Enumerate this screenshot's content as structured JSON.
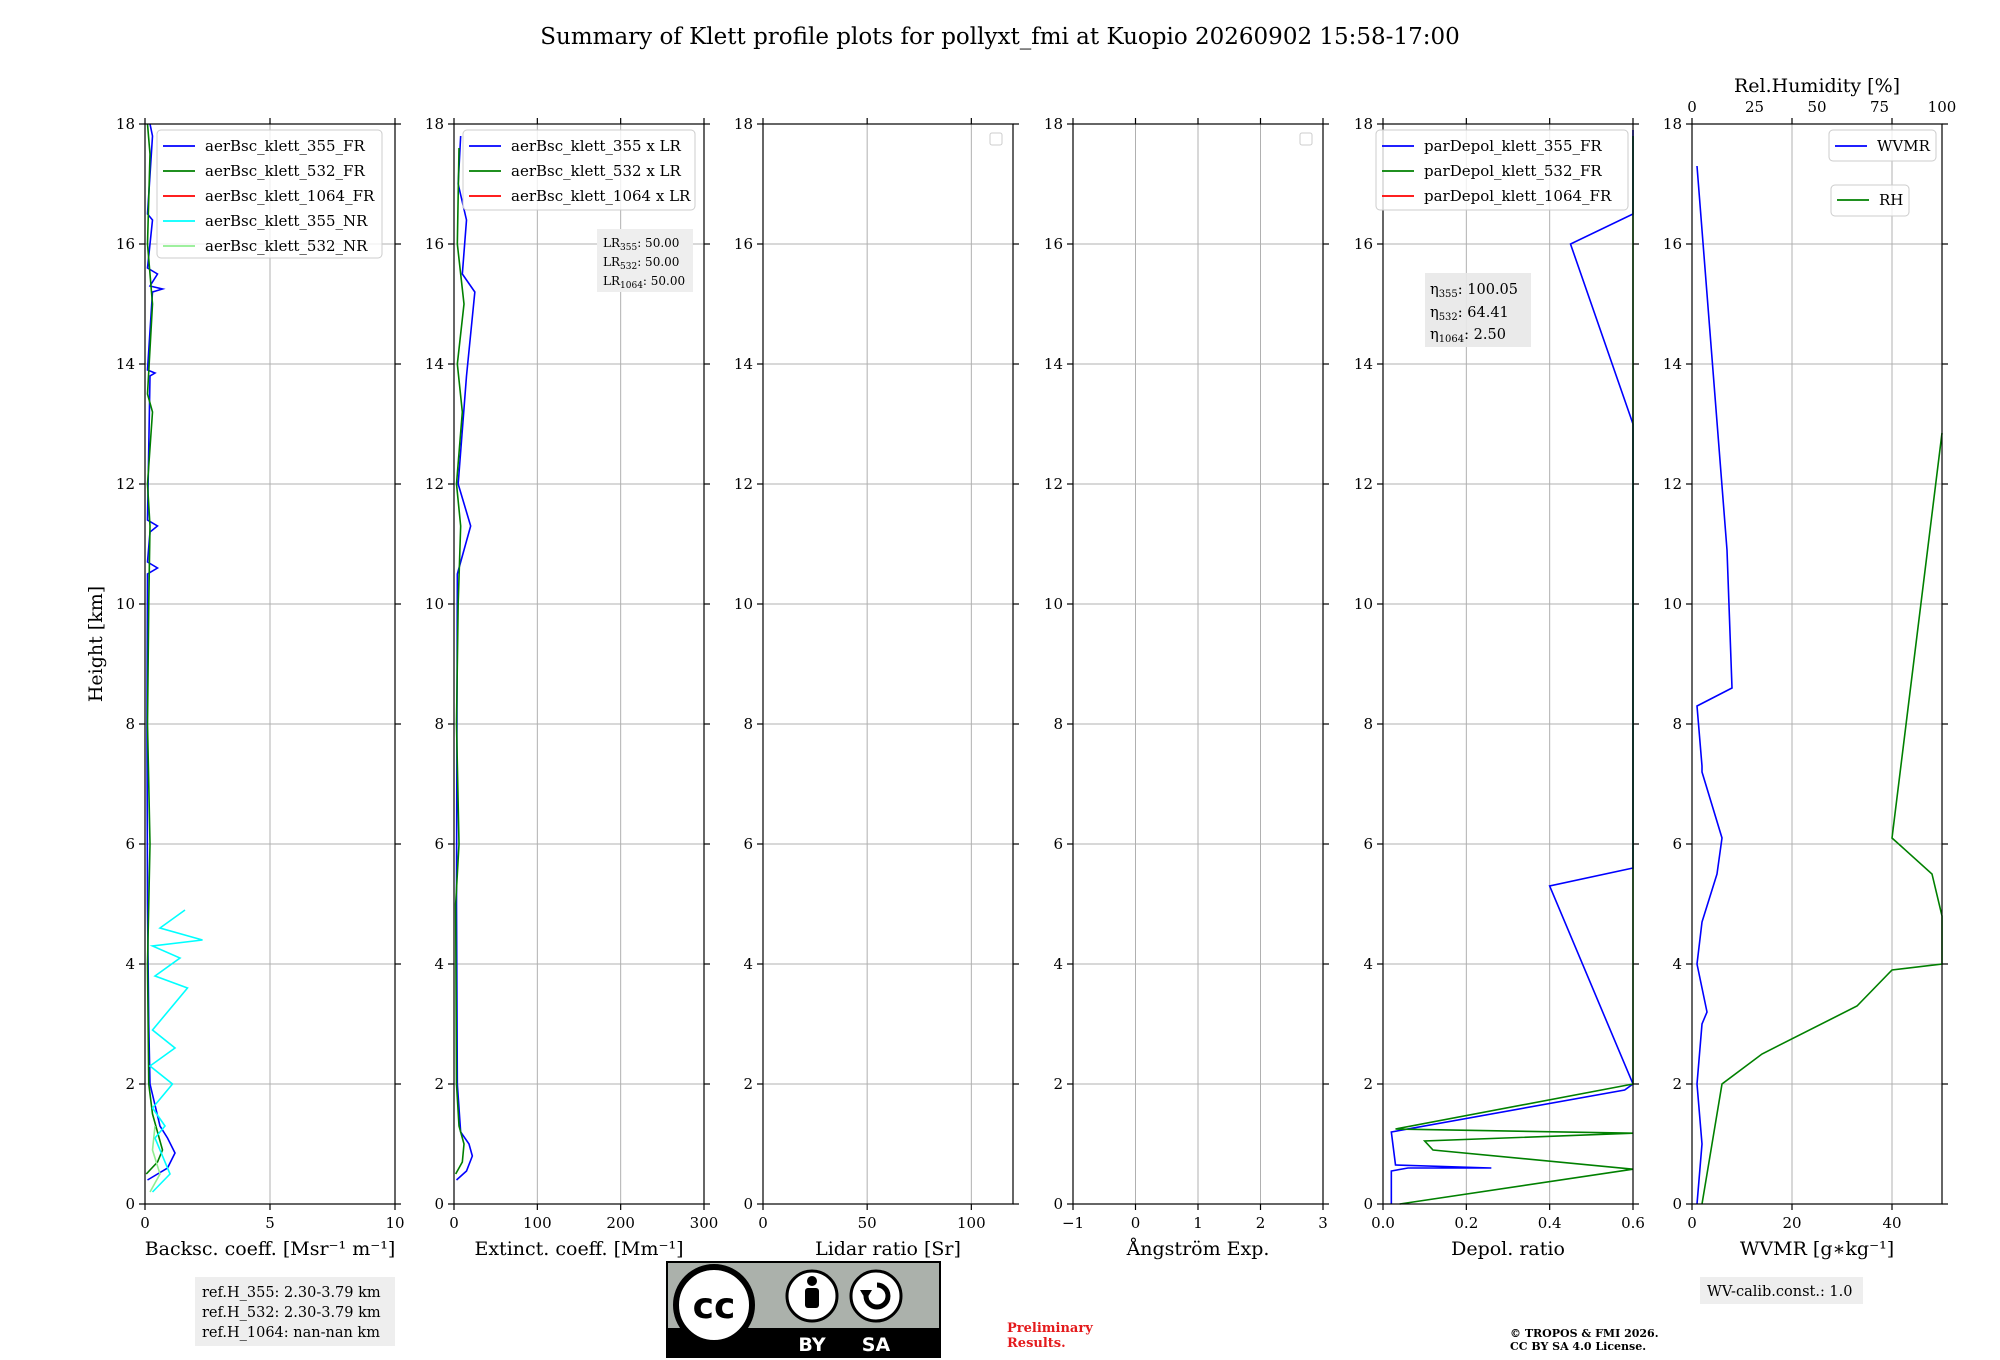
{
  "figure": {
    "title": "Summary of Klett profile plots for pollyxt_fmi at Kuopio 20260902 15:58-17:00",
    "ylabel": "Height [km]",
    "preliminary": [
      "Preliminary",
      "Results."
    ],
    "copyright": [
      "© TROPOS & FMI 2026.",
      "CC BY SA 4.0 License."
    ],
    "cc_badge": {
      "by": "BY",
      "sa": "SA",
      "cc": "cc"
    },
    "colors": {
      "blue": "#0000ff",
      "green": "#008000",
      "red": "#ff0000",
      "cyan": "#00ffff",
      "lightgreen": "#90ee90",
      "grid": "#b0b0b0"
    }
  },
  "chart_data": [
    {
      "type": "line",
      "xlabel": "Backsc. coeff. [Msr⁻¹ m⁻¹]",
      "xlim": [
        0,
        10
      ],
      "ylim": [
        0,
        18
      ],
      "xticks": [
        "0",
        "5",
        "10"
      ],
      "xtick_values": [
        0,
        5,
        10
      ],
      "yticks": [
        "0",
        "2",
        "4",
        "6",
        "8",
        "10",
        "12",
        "14",
        "16",
        "18"
      ],
      "legend_position": "top-right",
      "legend": [
        "aerBsc_klett_355_FR",
        "aerBsc_klett_532_FR",
        "aerBsc_klett_1064_FR",
        "aerBsc_klett_355_NR",
        "aerBsc_klett_532_NR"
      ],
      "legend_colors": [
        "#0000ff",
        "#008000",
        "#ff0000",
        "#00ffff",
        "#90ee90"
      ],
      "series": [
        {
          "name": "aerBsc_klett_355_FR",
          "color": "#0000ff",
          "points": [
            [
              0.1,
              0.4
            ],
            [
              0.9,
              0.6
            ],
            [
              1.2,
              0.85
            ],
            [
              0.9,
              1.1
            ],
            [
              0.6,
              1.3
            ],
            [
              0.2,
              2.0
            ],
            [
              0.15,
              3.0
            ],
            [
              0.1,
              5.0
            ],
            [
              0.08,
              8.0
            ],
            [
              0.1,
              10.5
            ],
            [
              0.5,
              10.6
            ],
            [
              0.1,
              10.7
            ],
            [
              0.2,
              11.2
            ],
            [
              0.5,
              11.3
            ],
            [
              0.1,
              11.4
            ],
            [
              0.2,
              13.8
            ],
            [
              0.4,
              13.85
            ],
            [
              0.1,
              13.9
            ],
            [
              0.3,
              15.2
            ],
            [
              0.7,
              15.25
            ],
            [
              0.2,
              15.3
            ],
            [
              0.5,
              15.5
            ],
            [
              0.1,
              15.6
            ],
            [
              0.3,
              16.4
            ],
            [
              0.1,
              16.5
            ],
            [
              0.3,
              17.8
            ],
            [
              0.2,
              18.0
            ]
          ]
        },
        {
          "name": "aerBsc_klett_532_FR",
          "color": "#008000",
          "points": [
            [
              0.05,
              0.5
            ],
            [
              0.5,
              0.7
            ],
            [
              0.7,
              0.9
            ],
            [
              0.5,
              1.2
            ],
            [
              0.3,
              1.5
            ],
            [
              0.15,
              2.0
            ],
            [
              0.1,
              4.0
            ],
            [
              0.2,
              6.0
            ],
            [
              0.1,
              8.0
            ],
            [
              0.15,
              10.0
            ],
            [
              0.2,
              11.3
            ],
            [
              0.1,
              12.0
            ],
            [
              0.3,
              13.2
            ],
            [
              0.1,
              13.5
            ],
            [
              0.3,
              15.0
            ],
            [
              0.1,
              16.0
            ],
            [
              0.2,
              17.5
            ],
            [
              0.1,
              18.0
            ]
          ]
        },
        {
          "name": "aerBsc_klett_355_NR",
          "color": "#00ffff",
          "points": [
            [
              0.3,
              0.2
            ],
            [
              1.0,
              0.5
            ],
            [
              0.4,
              1.1
            ],
            [
              0.8,
              1.3
            ],
            [
              0.3,
              1.6
            ],
            [
              1.1,
              2.0
            ],
            [
              0.2,
              2.3
            ],
            [
              1.2,
              2.6
            ],
            [
              0.3,
              2.9
            ],
            [
              1.7,
              3.6
            ],
            [
              0.4,
              3.8
            ],
            [
              1.4,
              4.1
            ],
            [
              0.3,
              4.3
            ],
            [
              2.3,
              4.4
            ],
            [
              0.6,
              4.6
            ],
            [
              1.6,
              4.9
            ]
          ]
        },
        {
          "name": "aerBsc_klett_532_NR",
          "color": "#90ee90",
          "points": [
            [
              0.2,
              0.2
            ],
            [
              0.6,
              0.5
            ],
            [
              0.3,
              0.9
            ],
            [
              0.4,
              1.3
            ]
          ]
        }
      ],
      "textbox": [
        "ref.H_355: 2.30-3.79 km",
        "ref.H_532: 2.30-3.79 km",
        "ref.H_1064: nan-nan km"
      ]
    },
    {
      "type": "line",
      "xlabel": "Extinct. coeff. [Mm⁻¹]",
      "xlim": [
        0,
        300
      ],
      "ylim": [
        0,
        18
      ],
      "xticks": [
        "0",
        "100",
        "200",
        "300"
      ],
      "xtick_values": [
        0,
        100,
        200,
        300
      ],
      "yticks": [
        "0",
        "2",
        "4",
        "6",
        "8",
        "10",
        "12",
        "14",
        "16",
        "18"
      ],
      "legend_position": "top-right",
      "legend": [
        "aerBsc_klett_355 x LR",
        "aerBsc_klett_532 x LR",
        "aerBsc_klett_1064 x LR"
      ],
      "legend_colors": [
        "#0000ff",
        "#008000",
        "#ff0000"
      ],
      "series": [
        {
          "name": "aerBsc_klett_355 x LR",
          "color": "#0000ff",
          "points": [
            [
              3,
              0.4
            ],
            [
              15,
              0.55
            ],
            [
              22,
              0.8
            ],
            [
              18,
              1.0
            ],
            [
              8,
              1.2
            ],
            [
              4,
              2.0
            ],
            [
              3,
              5.0
            ],
            [
              4,
              10.5
            ],
            [
              20,
              11.3
            ],
            [
              5,
              12.0
            ],
            [
              15,
              13.8
            ],
            [
              25,
              15.2
            ],
            [
              10,
              15.5
            ],
            [
              15,
              16.4
            ],
            [
              5,
              17.0
            ],
            [
              8,
              17.8
            ]
          ]
        },
        {
          "name": "aerBsc_klett_532 x LR",
          "color": "#008000",
          "points": [
            [
              2,
              0.5
            ],
            [
              10,
              0.7
            ],
            [
              12,
              1.0
            ],
            [
              6,
              1.3
            ],
            [
              3,
              2.0
            ],
            [
              2,
              5.0
            ],
            [
              6,
              6.0
            ],
            [
              3,
              8.0
            ],
            [
              5,
              10.0
            ],
            [
              8,
              11.3
            ],
            [
              3,
              12.0
            ],
            [
              10,
              13.2
            ],
            [
              4,
              14.0
            ],
            [
              12,
              15.0
            ],
            [
              4,
              16.0
            ],
            [
              6,
              17.6
            ]
          ]
        }
      ],
      "textbox": [
        "LR355: 50.00",
        "LR532: 50.00",
        "LR1064: 50.00"
      ]
    },
    {
      "type": "line",
      "xlabel": "Lidar ratio [Sr]",
      "xlim": [
        0,
        120
      ],
      "ylim": [
        0,
        18
      ],
      "xticks": [
        "0",
        "50",
        "100"
      ],
      "xtick_values": [
        0,
        50,
        100
      ],
      "yticks": [
        "0",
        "2",
        "4",
        "6",
        "8",
        "10",
        "12",
        "14",
        "16",
        "18"
      ],
      "series": []
    },
    {
      "type": "line",
      "xlabel": "Ångström Exp.",
      "xlim": [
        -1,
        3
      ],
      "ylim": [
        0,
        18
      ],
      "xticks": [
        "−1",
        "0",
        "1",
        "2",
        "3"
      ],
      "xtick_values": [
        -1,
        0,
        1,
        2,
        3
      ],
      "yticks": [
        "0",
        "2",
        "4",
        "6",
        "8",
        "10",
        "12",
        "14",
        "16",
        "18"
      ],
      "series": []
    },
    {
      "type": "line",
      "xlabel": "Depol. ratio",
      "xlim": [
        0,
        0.6
      ],
      "ylim": [
        0,
        18
      ],
      "xticks": [
        "0.0",
        "0.2",
        "0.4",
        "0.6"
      ],
      "xtick_values": [
        0,
        0.2,
        0.4,
        0.6
      ],
      "yticks": [
        "0",
        "2",
        "4",
        "6",
        "8",
        "10",
        "12",
        "14",
        "16",
        "18"
      ],
      "legend_position": "top-right",
      "legend": [
        "parDepol_klett_355_FR",
        "parDepol_klett_532_FR",
        "parDepol_klett_1064_FR"
      ],
      "legend_colors": [
        "#0000ff",
        "#008000",
        "#ff0000"
      ],
      "series": [
        {
          "name": "parDepol_klett_355_FR",
          "color": "#0000ff",
          "points": [
            [
              0.02,
              0.0
            ],
            [
              0.02,
              0.55
            ],
            [
              0.06,
              0.6
            ],
            [
              0.26,
              0.6
            ],
            [
              0.03,
              0.65
            ],
            [
              0.02,
              1.2
            ],
            [
              0.58,
              1.9
            ],
            [
              0.6,
              2.0
            ],
            [
              0.4,
              5.3
            ],
            [
              0.6,
              5.6
            ],
            [
              0.6,
              9.9
            ],
            [
              0.6,
              13.0
            ],
            [
              0.45,
              16.0
            ],
            [
              0.6,
              16.5
            ],
            [
              0.6,
              17.9
            ]
          ]
        },
        {
          "name": "parDepol_klett_532_FR",
          "color": "#008000",
          "points": [
            [
              0.04,
              0.0
            ],
            [
              0.6,
              0.58
            ],
            [
              0.12,
              0.9
            ],
            [
              0.1,
              1.05
            ],
            [
              0.6,
              1.18
            ],
            [
              0.03,
              1.25
            ],
            [
              0.6,
              2.0
            ],
            [
              0.6,
              3.8
            ],
            [
              0.6,
              4.8
            ],
            [
              0.6,
              5.6
            ],
            [
              0.6,
              6.3
            ],
            [
              0.6,
              8.4
            ],
            [
              0.6,
              12.0
            ],
            [
              0.6,
              15.6
            ],
            [
              0.6,
              17.8
            ]
          ]
        }
      ],
      "textbox": [
        "η355: 100.05",
        "η532: 64.41",
        "η1064: 2.50"
      ]
    },
    {
      "type": "line",
      "xlabel": "WVMR [g∗kg⁻¹]",
      "xlim": [
        0,
        50
      ],
      "ylim": [
        0,
        18
      ],
      "xticks": [
        "0",
        "20",
        "40"
      ],
      "xtick_values": [
        0,
        20,
        40
      ],
      "yticks": [
        "0",
        "2",
        "4",
        "6",
        "8",
        "10",
        "12",
        "14",
        "16",
        "18"
      ],
      "secondary_xlabel": "Rel.Humidity [%]",
      "secondary_xlim": [
        0,
        100
      ],
      "secondary_xticks": [
        "0",
        "25",
        "50",
        "75",
        "100"
      ],
      "secondary_xtick_values": [
        0,
        25,
        50,
        75,
        100
      ],
      "legend": [
        "WVMR",
        "RH"
      ],
      "legend_colors": [
        "#0000ff",
        "#008000"
      ],
      "series": [
        {
          "name": "WVMR",
          "color": "#0000ff",
          "points": [
            [
              1,
              0.0
            ],
            [
              2,
              1.0
            ],
            [
              1,
              2.0
            ],
            [
              2,
              3.0
            ],
            [
              3,
              3.2
            ],
            [
              1,
              4.0
            ],
            [
              2,
              4.7
            ],
            [
              5,
              5.5
            ],
            [
              6,
              6.1
            ],
            [
              2,
              7.2
            ],
            [
              2,
              7.3
            ],
            [
              1,
              8.3
            ],
            [
              8,
              8.6
            ],
            [
              7,
              10.9
            ],
            [
              1,
              17.3
            ]
          ]
        },
        {
          "name": "RH",
          "color": "#008000",
          "points": [
            [
              2,
              0.0
            ],
            [
              4,
              1.0
            ],
            [
              6,
              2.0
            ],
            [
              14,
              2.5
            ],
            [
              33,
              3.3
            ],
            [
              40,
              3.9
            ],
            [
              50,
              4.0
            ],
            [
              50,
              4.5
            ],
            [
              50,
              4.8
            ],
            [
              48,
              5.5
            ],
            [
              40,
              6.1
            ],
            [
              50,
              12.85
            ]
          ]
        }
      ],
      "textbox": [
        "WV-calib.const.: 1.0"
      ]
    }
  ]
}
